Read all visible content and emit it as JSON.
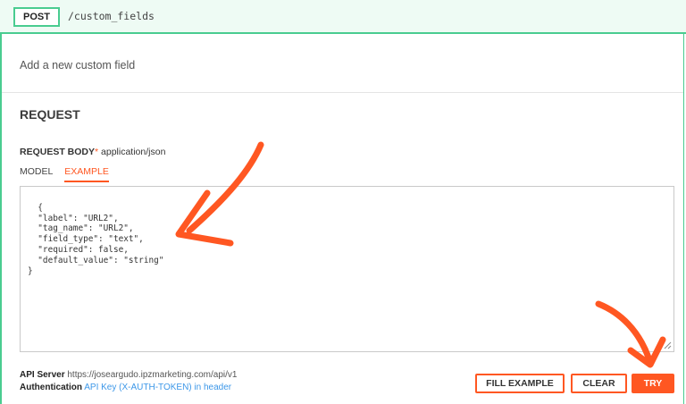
{
  "endpoint": {
    "method": "POST",
    "path": "/custom_fields"
  },
  "description": "Add a new custom field",
  "request": {
    "section_title": "REQUEST",
    "body_label": "REQUEST BODY",
    "required_mark": "*",
    "content_type": "application/json",
    "tabs": [
      {
        "label": "MODEL",
        "active": false
      },
      {
        "label": "EXAMPLE",
        "active": true
      }
    ],
    "example_body": "{\n  \"label\": \"URL2\",\n  \"tag_name\": \"URL2\",\n  \"field_type\": \"text\",\n  \"required\": false,\n  \"default_value\": \"string\"\n}"
  },
  "footer": {
    "api_server_label": "API Server",
    "api_server_url": "https://joseargudo.ipzmarketing.com/api/v1",
    "auth_label": "Authentication",
    "auth_value": "API Key (X-AUTH-TOKEN) in header"
  },
  "buttons": {
    "fill_example": "FILL EXAMPLE",
    "clear": "CLEAR",
    "try": "TRY"
  },
  "colors": {
    "post_green": "#49cc90",
    "accent_orange": "#ff5722",
    "link_blue": "#3c97e8"
  }
}
